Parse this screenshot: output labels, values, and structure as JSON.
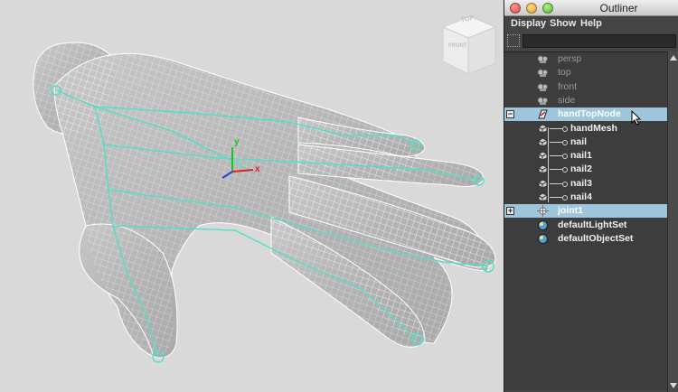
{
  "window": {
    "title": "Outliner"
  },
  "menu": {
    "display": "Display",
    "show": "Show",
    "help": "Help"
  },
  "search": {
    "value": ""
  },
  "viewcube": {
    "top": "TOP",
    "front": "FRONT"
  },
  "axes": {
    "x": "x",
    "y": "y"
  },
  "outliner": {
    "items": [
      {
        "label": "persp",
        "type": "camera",
        "state": "dim"
      },
      {
        "label": "top",
        "type": "camera",
        "state": "dim"
      },
      {
        "label": "front",
        "type": "camera",
        "state": "dim"
      },
      {
        "label": "side",
        "type": "camera",
        "state": "dim"
      },
      {
        "label": "handTopNode",
        "type": "transform",
        "state": "selected",
        "expander": "collapse"
      },
      {
        "label": "handMesh",
        "type": "mesh",
        "state": "child"
      },
      {
        "label": "nail",
        "type": "mesh",
        "state": "child"
      },
      {
        "label": "nail1",
        "type": "mesh",
        "state": "child"
      },
      {
        "label": "nail2",
        "type": "mesh",
        "state": "child"
      },
      {
        "label": "nail3",
        "type": "mesh",
        "state": "child"
      },
      {
        "label": "nail4",
        "type": "mesh",
        "state": "child"
      },
      {
        "label": "joint1",
        "type": "joint",
        "state": "selected",
        "expander": "expand"
      },
      {
        "label": "defaultLightSet",
        "type": "set",
        "state": "normal"
      },
      {
        "label": "defaultObjectSet",
        "type": "set",
        "state": "normal"
      }
    ]
  },
  "colors": {
    "selection": "#9ec5db",
    "skeleton": "#4fe0c8",
    "axis_x": "#e02020",
    "axis_y": "#20c020",
    "axis_z": "#2040e0"
  }
}
